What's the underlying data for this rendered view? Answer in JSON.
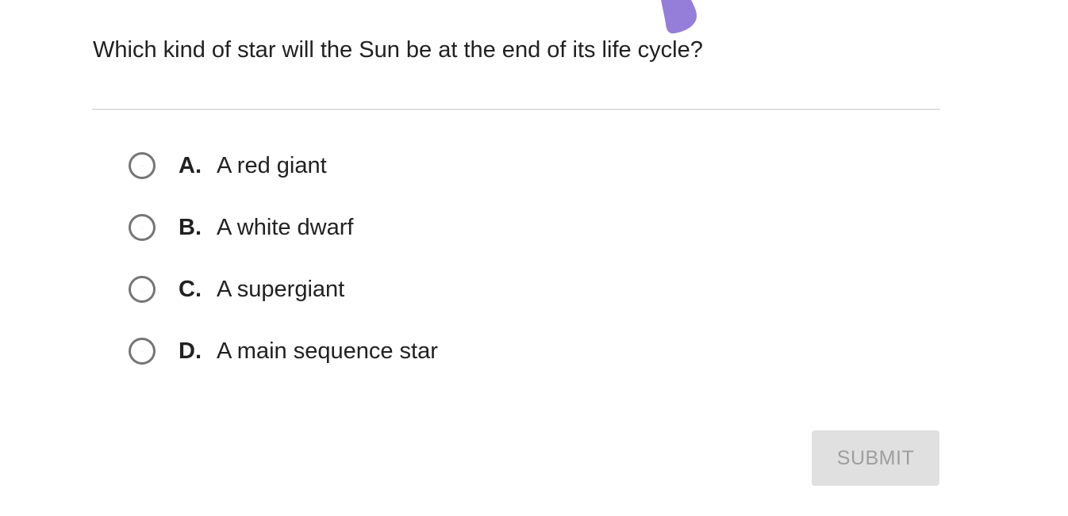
{
  "question": {
    "text": "Which kind of star will the Sun be at the end of its life cycle?"
  },
  "options": [
    {
      "letter": "A.",
      "text": "A red giant",
      "selected": false
    },
    {
      "letter": "B.",
      "text": "A white dwarf",
      "selected": false
    },
    {
      "letter": "C.",
      "text": "A supergiant",
      "selected": false
    },
    {
      "letter": "D.",
      "text": "A main sequence star",
      "selected": false
    }
  ],
  "submit": {
    "label": "SUBMIT",
    "enabled": false
  },
  "colors": {
    "text": "#212121",
    "radio_border": "#757575",
    "divider": "#e0e0e0",
    "submit_bg": "#e0e0e0",
    "submit_text": "#9e9e9e",
    "brush_mark": "#8a6fd6"
  }
}
